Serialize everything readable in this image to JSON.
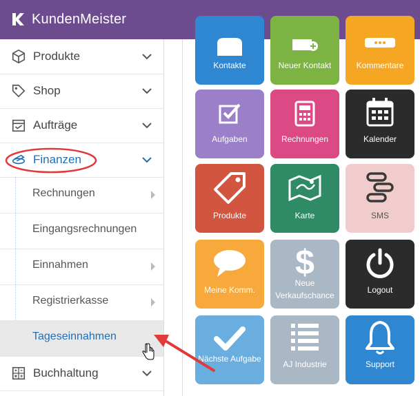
{
  "app": {
    "title": "KundenMeister"
  },
  "sidebar": {
    "items": [
      {
        "label": "Produkte",
        "icon": "box-icon"
      },
      {
        "label": "Shop",
        "icon": "tag-icon"
      },
      {
        "label": "Aufträge",
        "icon": "clipboard-icon"
      },
      {
        "label": "Finanzen",
        "icon": "coins-icon",
        "active": true
      },
      {
        "label": "Buchhaltung",
        "icon": "calculator-icon"
      }
    ],
    "finanzen_sub": [
      {
        "label": "Rechnungen",
        "has_submenu": true
      },
      {
        "label": "Eingangsrechnungen",
        "has_submenu": false
      },
      {
        "label": "Einnahmen",
        "has_submenu": true
      },
      {
        "label": "Registrierkasse",
        "has_submenu": true
      },
      {
        "label": "Tageseinnahmen",
        "has_submenu": false,
        "hovered": true
      }
    ]
  },
  "tiles": [
    {
      "label": "Kontakte",
      "color": "#2f87d1",
      "icon": "contact-icon"
    },
    {
      "label": "Neuer Kontakt",
      "color": "#7cb342",
      "icon": "new-contact-icon"
    },
    {
      "label": "Kommentare",
      "color": "#f5a623",
      "icon": "comments-icon"
    },
    {
      "label": "Aufgaben",
      "color": "#9b7fc8",
      "icon": "task-check-icon"
    },
    {
      "label": "Rechnungen",
      "color": "#dc4a86",
      "icon": "calculator-icon"
    },
    {
      "label": "Kalender",
      "color": "#2b2b2b",
      "icon": "calendar-icon"
    },
    {
      "label": "Produkte",
      "color": "#d1553f",
      "icon": "tag-icon"
    },
    {
      "label": "Karte",
      "color": "#2e8b65",
      "icon": "map-icon"
    },
    {
      "label": "SMS",
      "color": "#f1cccc",
      "icon": "sms-icon"
    },
    {
      "label": "Meine Komm.",
      "color": "#f8a93b",
      "icon": "speech-bubble-icon"
    },
    {
      "label": "Neue Verkaufschance",
      "color": "#aab7c4",
      "icon": "dollar-icon"
    },
    {
      "label": "Logout",
      "color": "#2b2b2b",
      "icon": "power-icon"
    },
    {
      "label": "Nächste Aufgabe",
      "color": "#6aaee0",
      "icon": "checkmark-icon"
    },
    {
      "label": "AJ Industrie",
      "color": "#aab7c4",
      "icon": "list-icon"
    },
    {
      "label": "Support",
      "color": "#2f87d1",
      "icon": "bell-icon"
    }
  ],
  "colors": {
    "topbar": "#6c4c8e",
    "active_menu": "#1f6fb5",
    "annotation": "#e03a3a"
  }
}
